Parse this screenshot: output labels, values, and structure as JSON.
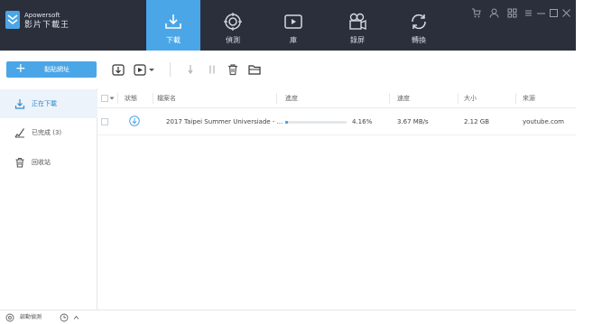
{
  "app": {
    "brand_line1": "Apowersoft",
    "brand_line2": "影片下載王",
    "accent_color": "#4aa6e6",
    "titlebar_color": "#2b2f3b"
  },
  "nav_tabs": [
    {
      "label": "下載",
      "icon": "download-icon",
      "active": true
    },
    {
      "label": "偵測",
      "icon": "detect-icon",
      "active": false
    },
    {
      "label": "庫",
      "icon": "library-icon",
      "active": false
    },
    {
      "label": "錄屏",
      "icon": "record-icon",
      "active": false
    },
    {
      "label": "轉換",
      "icon": "convert-icon",
      "active": false
    }
  ],
  "window_controls": [
    "cart-icon",
    "user-icon",
    "grid-icon",
    "menu-icon",
    "minimize-icon",
    "maximize-icon",
    "close-icon"
  ],
  "toolbar": {
    "paste_label": "黏貼網址",
    "icons": [
      "import-icon",
      "video-add-icon",
      "dropdown-icon",
      "resume-icon",
      "pause-icon",
      "delete-icon",
      "folder-icon"
    ]
  },
  "sidebar": {
    "items": [
      {
        "label": "正在下載",
        "icon": "download-icon",
        "active": true
      },
      {
        "label": "已完成 (3)",
        "icon": "check-icon",
        "active": false
      },
      {
        "label": "回收站",
        "icon": "trash-icon",
        "active": false
      }
    ]
  },
  "table": {
    "headers": {
      "status": "狀態",
      "filename": "檔案名",
      "progress": "進度",
      "speed": "速度",
      "size": "大小",
      "source": "來源"
    },
    "rows": [
      {
        "filename": "2017 Taipei Summer Universiade - ...",
        "progress_text": "4.16%",
        "progress_value": 4.16,
        "speed": "3.67 MB/s",
        "size": "2.12 GB",
        "source": "youtube.com"
      }
    ]
  },
  "statusbar": {
    "auto_detect_label": "啟動偵測",
    "timer_icon": "timer-icon",
    "chevron_icon": "chevron-up-icon"
  }
}
